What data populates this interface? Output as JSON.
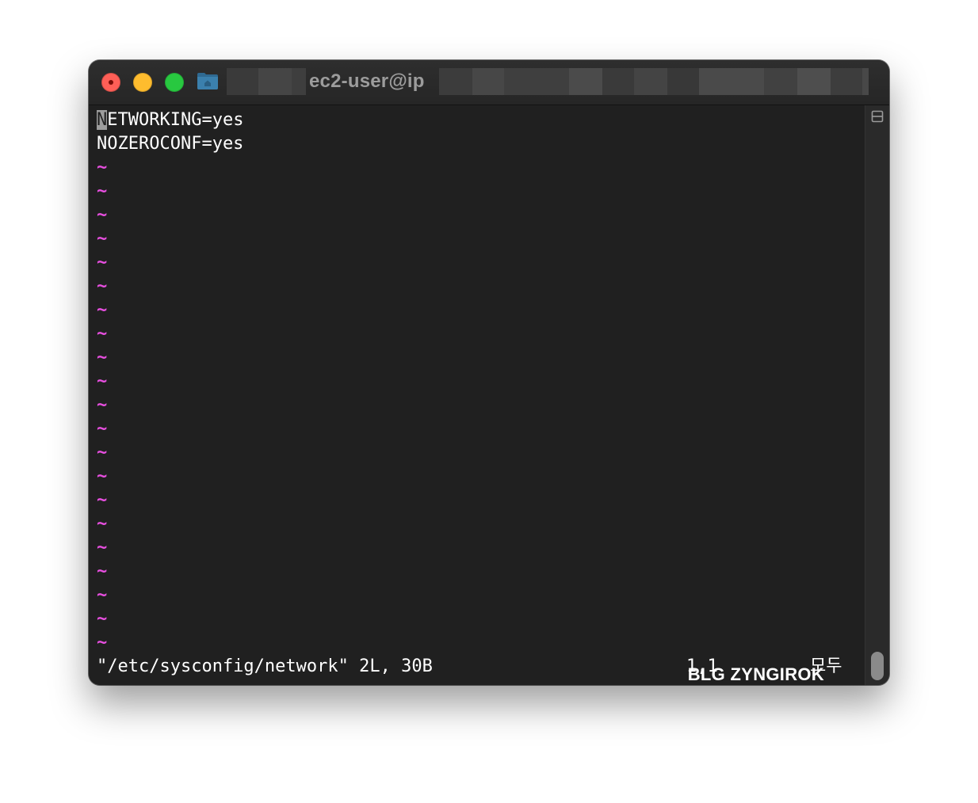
{
  "window": {
    "title": "ec2-user@ip",
    "title_redacted_blocks": [
      {
        "color": "#3a3a3a"
      },
      {
        "color": "#454545"
      },
      {
        "color": "#3e3e3e"
      }
    ],
    "tail_blocks": [
      {
        "color": "#3c3c3c"
      },
      {
        "color": "#474747"
      },
      {
        "color": "#3f3f3f"
      },
      {
        "color": "#4b4b4b"
      },
      {
        "color": "#3a3a3a"
      },
      {
        "color": "#444444"
      },
      {
        "color": "#383838"
      },
      {
        "color": "#4a4a4a"
      },
      {
        "color": "#414141"
      },
      {
        "color": "#4e4e4e"
      },
      {
        "color": "#3d3d3d"
      },
      {
        "color": "#484848"
      }
    ]
  },
  "editor": {
    "lines": [
      {
        "cursor": "N",
        "rest": "ETWORKING=yes"
      },
      {
        "cursor": "",
        "rest": "NOZEROCONF=yes"
      }
    ],
    "tilde": "~",
    "tilde_count": 21,
    "status": {
      "file": "\"/etc/sysconfig/network\" 2L, 30B",
      "position": "1,1",
      "scroll": "모두"
    }
  },
  "watermark": "BLG ZYNGIROK",
  "icons": {
    "close": "close-icon",
    "minimize": "minimize-icon",
    "maximize": "maximize-icon",
    "folder": "folder-home-icon",
    "split": "split-pane-icon"
  },
  "colors": {
    "tilde": "#e84fe0",
    "background": "#202020",
    "text": "#ffffff"
  }
}
